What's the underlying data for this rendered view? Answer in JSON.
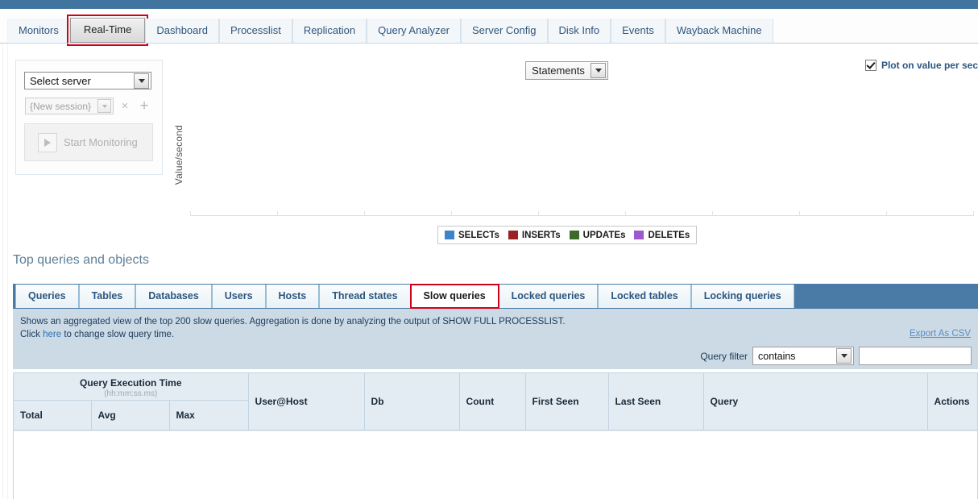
{
  "nav": {
    "tabs": [
      {
        "label": "Monitors",
        "active": false
      },
      {
        "label": "Real-Time",
        "active": true,
        "highlighted": true
      },
      {
        "label": "Dashboard",
        "active": false
      },
      {
        "label": "Processlist",
        "active": false
      },
      {
        "label": "Replication",
        "active": false
      },
      {
        "label": "Query Analyzer",
        "active": false
      },
      {
        "label": "Server Config",
        "active": false
      },
      {
        "label": "Disk Info",
        "active": false
      },
      {
        "label": "Events",
        "active": false
      },
      {
        "label": "Wayback Machine",
        "active": false
      }
    ]
  },
  "control_panel": {
    "server_select": {
      "value": "Select server"
    },
    "session_select": {
      "value": "{New session}"
    },
    "remove_session_icon": "×",
    "add_session_icon": "+",
    "start_monitoring_label": "Start Monitoring"
  },
  "chart": {
    "statements_select": {
      "value": "Statements"
    },
    "plot_per_sec": {
      "label": "Plot on value per sec",
      "checked": true
    },
    "ylabel": "Value/second",
    "legend": [
      {
        "label": "SELECTs",
        "color": "#3d85c6"
      },
      {
        "label": "INSERTs",
        "color": "#9b2222"
      },
      {
        "label": "UPDATEs",
        "color": "#3a6b2a"
      },
      {
        "label": "DELETEs",
        "color": "#9b59cc"
      }
    ]
  },
  "chart_data": {
    "type": "line",
    "title": "",
    "xlabel": "",
    "ylabel": "Value/second",
    "series": [
      {
        "name": "SELECTs",
        "color": "#3d85c6",
        "values": []
      },
      {
        "name": "INSERTs",
        "color": "#9b2222",
        "values": []
      },
      {
        "name": "UPDATEs",
        "color": "#3a6b2a",
        "values": []
      },
      {
        "name": "DELETEs",
        "color": "#9b59cc",
        "values": []
      }
    ],
    "x": [],
    "grid": false,
    "legend_position": "bottom"
  },
  "section": {
    "title": "Top queries and objects"
  },
  "subtabs": [
    {
      "label": "Queries",
      "active": false
    },
    {
      "label": "Tables",
      "active": false
    },
    {
      "label": "Databases",
      "active": false
    },
    {
      "label": "Users",
      "active": false
    },
    {
      "label": "Hosts",
      "active": false
    },
    {
      "label": "Thread states",
      "active": false
    },
    {
      "label": "Slow queries",
      "active": true,
      "highlighted": true
    },
    {
      "label": "Locked queries",
      "active": false
    },
    {
      "label": "Locked tables",
      "active": false
    },
    {
      "label": "Locking queries",
      "active": false
    }
  ],
  "info": {
    "line1_before": "Shows an aggregated view of the top 200 slow queries. Aggregation is done by analyzing the output of SHOW FULL PROCESSLIST.",
    "line2_before": "Click ",
    "link": "here",
    "line2_after": " to change slow query time.",
    "export_label": "Export As CSV",
    "filter_label": "Query filter",
    "filter_operator": "contains",
    "filter_value": "",
    "filter_placeholder": ""
  },
  "table": {
    "group_header": "Query Execution Time",
    "group_header_sub": "(hh:mm:ss.ms)",
    "sub_headers": [
      "Total",
      "Avg",
      "Max"
    ],
    "headers": [
      "User@Host",
      "Db",
      "Count",
      "First Seen",
      "Last Seen",
      "Query",
      "Actions"
    ],
    "rows": []
  }
}
